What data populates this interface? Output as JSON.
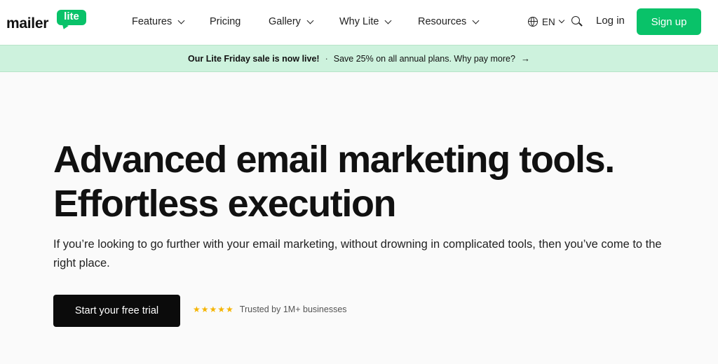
{
  "header": {
    "logo_word": "mailer",
    "logo_badge": "lite",
    "nav": [
      {
        "label": "Features",
        "has_menu": true
      },
      {
        "label": "Pricing",
        "has_menu": false
      },
      {
        "label": "Gallery",
        "has_menu": true
      },
      {
        "label": "Why Lite",
        "has_menu": true
      },
      {
        "label": "Resources",
        "has_menu": true
      }
    ],
    "language": "EN",
    "icons": {
      "language": "globe-icon",
      "search": "search-icon",
      "menu": "chevron-down-icon"
    },
    "login_label": "Log in",
    "signup_label": "Sign up"
  },
  "banner": {
    "bold_text": "Our Lite Friday sale is now live!",
    "separator": "·",
    "text": "Save 25% on all annual plans. Why pay more?",
    "arrow": "→"
  },
  "hero": {
    "headline_line1": "Advanced email marketing tools.",
    "headline_line2": "Effortless execution",
    "subcopy": "If you’re looking to go further with your email marketing, without drowning in complicated tools, then you’ve come to the right place.",
    "cta_label": "Start your free trial",
    "stars": "★★★★★",
    "rating_value": 5,
    "rating_max": 5,
    "trust_text": "Trusted by 1M+ businesses"
  },
  "colors": {
    "brand_green": "#09c269",
    "banner_bg": "#cdf2dd",
    "cta_bg": "#0b0b0b",
    "star": "#f5b400"
  }
}
